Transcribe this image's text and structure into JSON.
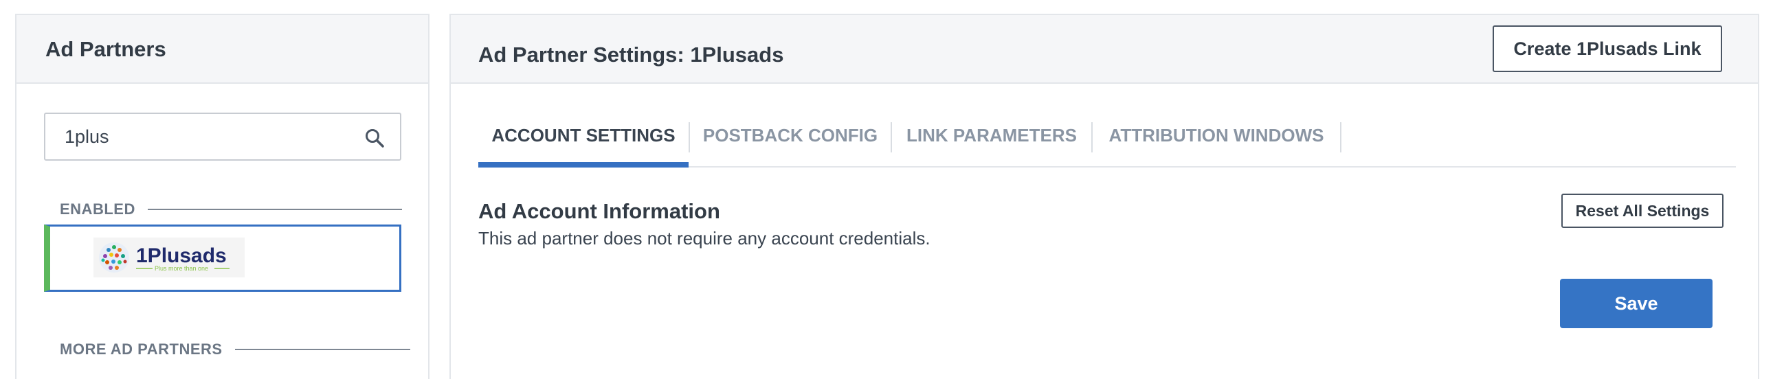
{
  "sidebar": {
    "title": "Ad Partners",
    "search": {
      "value": "1plus",
      "icon": "search-icon"
    },
    "enabled_label": "ENABLED",
    "more_label": "MORE AD PARTNERS",
    "enabled_partners": [
      {
        "name": "1Plusads",
        "logo_text": "1Plusads",
        "logo_tagline": "Plus more than one"
      }
    ]
  },
  "main": {
    "title": "Ad Partner Settings: 1Plusads",
    "create_link_label": "Create 1Plusads Link",
    "tabs": [
      {
        "label": "ACCOUNT SETTINGS",
        "active": true
      },
      {
        "label": "POSTBACK CONFIG",
        "active": false
      },
      {
        "label": "LINK PARAMETERS",
        "active": false
      },
      {
        "label": "ATTRIBUTION WINDOWS",
        "active": false
      }
    ],
    "account": {
      "heading": "Ad Account Information",
      "description": "This ad partner does not require any account credentials.",
      "reset_label": "Reset All Settings",
      "save_label": "Save"
    }
  },
  "colors": {
    "accent": "#3574c5",
    "enabled_indicator": "#5cb85c",
    "header_bg": "#f5f6f8"
  }
}
